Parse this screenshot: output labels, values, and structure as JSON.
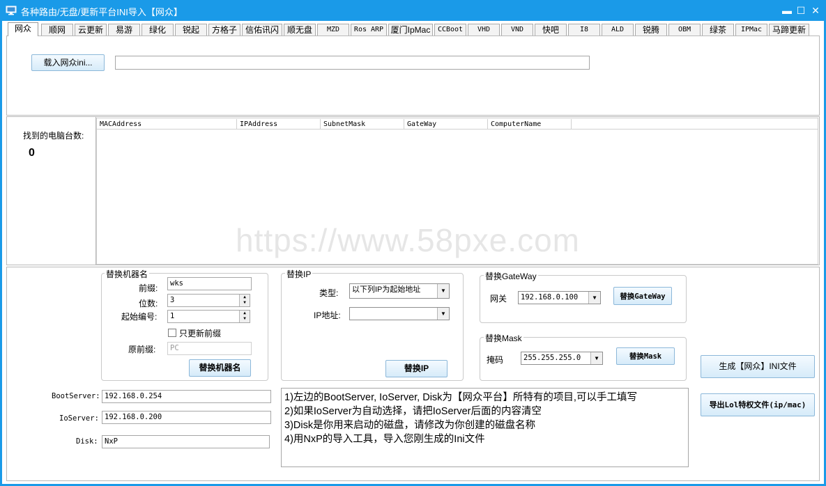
{
  "window": {
    "title": "各种路由/无盘/更新平台INI导入【网众】",
    "minimize": "▬",
    "maximize": "☐",
    "close": "✕"
  },
  "tabs": [
    {
      "label": "网众",
      "active": true
    },
    {
      "label": "顺网"
    },
    {
      "label": "云更新"
    },
    {
      "label": "易游"
    },
    {
      "label": "绿化"
    },
    {
      "label": "锐起"
    },
    {
      "label": "方格子"
    },
    {
      "label": "信佑讯闪"
    },
    {
      "label": "顺无盘"
    },
    {
      "label": "MZD"
    },
    {
      "label": "Ros ARP"
    },
    {
      "label": "厦门IpMac"
    },
    {
      "label": "CCBoot"
    },
    {
      "label": "VHD"
    },
    {
      "label": "VND"
    },
    {
      "label": "快吧"
    },
    {
      "label": "I8"
    },
    {
      "label": "ALD"
    },
    {
      "label": "锐腾"
    },
    {
      "label": "OBM"
    },
    {
      "label": "绿茶"
    },
    {
      "label": "IPMac"
    },
    {
      "label": "马蹄更新"
    }
  ],
  "load": {
    "button": "载入网众ini...",
    "path": ""
  },
  "found": {
    "label": "找到的电脑台数:",
    "count": "0"
  },
  "table": {
    "columns": [
      "MACAddress",
      "IPAddress",
      "SubnetMask",
      "GateWay",
      "ComputerName"
    ],
    "rows": []
  },
  "watermark": "https://www.58pxe.com",
  "rename": {
    "title": "替换机器名",
    "prefix_label": "前缀:",
    "prefix_value": "wks",
    "digits_label": "位数:",
    "digits_value": "3",
    "start_label": "起始编号:",
    "start_value": "1",
    "only_prefix_label": "只更新前缀",
    "only_prefix_checked": false,
    "orig_prefix_label": "原前缀:",
    "orig_prefix_value": "PC",
    "button": "替换机器名"
  },
  "replace_ip": {
    "title": "替换IP",
    "type_label": "类型:",
    "type_value": "以下列IP为起始地址",
    "ip_label": "IP地址:",
    "ip_value": "",
    "button": "替换IP"
  },
  "gateway": {
    "title": "替换GateWay",
    "label": "网关",
    "value": "192.168.0.100",
    "button": "替换GateWay"
  },
  "mask": {
    "title": "替换Mask",
    "label": "掩码",
    "value": "255.255.255.0",
    "button": "替换Mask"
  },
  "servers": {
    "boot_label": "BootServer:",
    "boot_value": "192.168.0.254",
    "io_label": "IoServer:",
    "io_value": "192.168.0.200",
    "disk_label": "Disk:",
    "disk_value": "NxP"
  },
  "notes": [
    "1)左边的BootServer, IoServer, Disk为【网众平台】所特有的项目,可以手工填写",
    "2)如果IoServer为自动选择，请把IoServer后面的内容清空",
    "3)Disk是你用来启动的磁盘，请修改为你创建的磁盘名称",
    "4)用NxP的导入工具，导入您刚生成的Ini文件"
  ],
  "actions": {
    "generate": "生成【网众】INI文件",
    "export": "导出Lol特权文件(ip/mac)"
  },
  "colors": {
    "titlebar": "#1a9ae8",
    "button_border": "#8bb7d9"
  }
}
